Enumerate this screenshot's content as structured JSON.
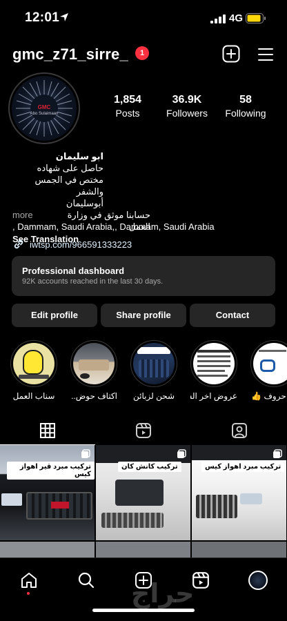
{
  "status_bar": {
    "time": "12:01",
    "network": "4G"
  },
  "header": {
    "username": "gmc_z71_sirre_",
    "notification_count": "1"
  },
  "avatar": {
    "line1": "GMC",
    "line2": "Abo Sulaimaan"
  },
  "stats": [
    {
      "value": "1,854",
      "label": "Posts"
    },
    {
      "value": "36.9K",
      "label": "Followers"
    },
    {
      "value": "58",
      "label": "Following"
    }
  ],
  "bio": {
    "name": "ابو سليمان",
    "line1": "حاصل على شهاده",
    "line2": "مختص في الجمس والشفر",
    "line3": "أبوسليمان",
    "more": "more",
    "verified": "حسابنا موثق في وزارة العمل",
    "location": ", Dammam, Saudi Arabia,, Dammam, Saudi Arabia",
    "see_translation": "See Translation"
  },
  "link": {
    "text": "iwtsp.com/966591333223"
  },
  "dashboard": {
    "title": "Professional dashboard",
    "subtitle": "92K accounts reached in the last 30 days."
  },
  "actions": {
    "edit": "Edit profile",
    "share": "Share profile",
    "contact": "Contact"
  },
  "highlights": [
    {
      "label": "سناب العمل"
    },
    {
      "label": "اكتاف حوض..."
    },
    {
      "label": "شحن لزبائن"
    },
    {
      "label": "عروض اخر الس..."
    },
    {
      "label": "حروف 👍"
    }
  ],
  "grid": [
    {
      "tag": "تركيب مبرد قير اهواز كيس"
    },
    {
      "tag": "تركيب كانش كان"
    },
    {
      "tag": "تركيب مبرد اهواز كيس"
    }
  ],
  "watermark": "حراج",
  "colors": {
    "accent_red": "#ff3040",
    "surface": "#262626",
    "muted": "#a8a8a8"
  }
}
